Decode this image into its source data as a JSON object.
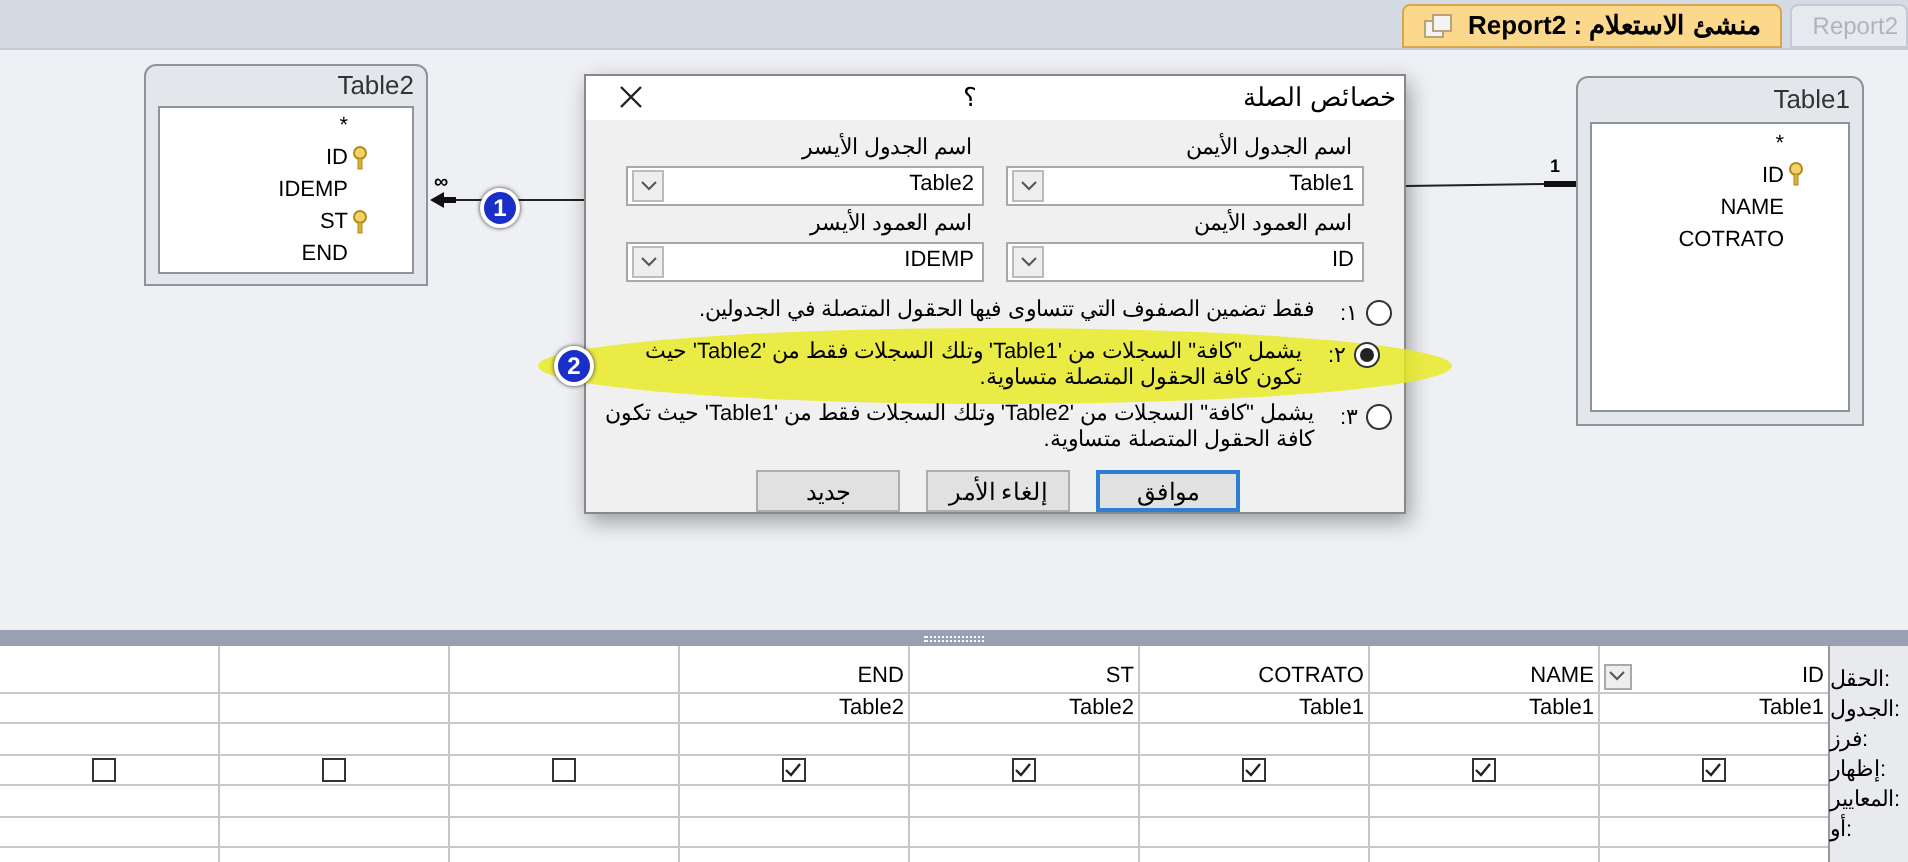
{
  "tabs": [
    {
      "label": "Report2",
      "selected": false
    },
    {
      "label": "Report2 : منشئ الاستعلام",
      "selected": true
    }
  ],
  "tables": [
    {
      "title": "Table1",
      "fields": [
        {
          "name": "*",
          "key": false
        },
        {
          "name": "ID",
          "key": true
        },
        {
          "name": "NAME",
          "key": false
        },
        {
          "name": "COTRATO",
          "key": false
        }
      ]
    },
    {
      "title": "Table2",
      "fields": [
        {
          "name": "*",
          "key": false
        },
        {
          "name": "ID",
          "key": true
        },
        {
          "name": "IDEMP",
          "key": false
        },
        {
          "name": "ST",
          "key": true
        },
        {
          "name": "END",
          "key": false
        }
      ]
    }
  ],
  "relationship": {
    "many_mark": "∞",
    "one_mark": "1"
  },
  "callouts": [
    "1",
    "2"
  ],
  "dialog": {
    "title": "خصائص الصلة",
    "help": "؟",
    "fields": [
      {
        "label": "اسم الجدول الأيمن",
        "value": "Table1"
      },
      {
        "label": "اسم الجدول الأيسر",
        "value": "Table2"
      },
      {
        "label": "اسم العمود الأيمن",
        "value": "ID"
      },
      {
        "label": "اسم العمود الأيسر",
        "value": "IDEMP"
      }
    ],
    "options": [
      {
        "number": "١:",
        "text": "فقط تضمين الصفوف التي تتساوى فيها الحقول المتصلة في الجدولين.",
        "selected": false,
        "highlighted": false
      },
      {
        "number": "٢:",
        "text": "يشمل \"كافة\" السجلات من 'Table1' وتلك السجلات فقط من 'Table2' حيث تكون كافة الحقول المتصلة متساوية.",
        "selected": true,
        "highlighted": true
      },
      {
        "number": "٣:",
        "text": "يشمل \"كافة\" السجلات من 'Table2' وتلك السجلات فقط من 'Table1' حيث تكون كافة الحقول المتصلة متساوية.",
        "selected": false,
        "highlighted": false
      }
    ],
    "buttons": [
      {
        "label": "موافق",
        "default": true
      },
      {
        "label": "إلغاء الأمر",
        "default": false
      },
      {
        "label": "جديد",
        "default": false
      }
    ]
  },
  "grid": {
    "row_labels": [
      "الحقل:",
      "الجدول:",
      "فرز:",
      "إظهار:",
      "المعايير:",
      "أو:"
    ],
    "columns": [
      {
        "field": "ID",
        "table": "Table1",
        "show": true
      },
      {
        "field": "NAME",
        "table": "Table1",
        "show": true
      },
      {
        "field": "COTRATO",
        "table": "Table1",
        "show": true
      },
      {
        "field": "ST",
        "table": "Table2",
        "show": true
      },
      {
        "field": "END",
        "table": "Table2",
        "show": true
      },
      {
        "show": false
      },
      {
        "show": false
      },
      {
        "show": false
      }
    ]
  }
}
